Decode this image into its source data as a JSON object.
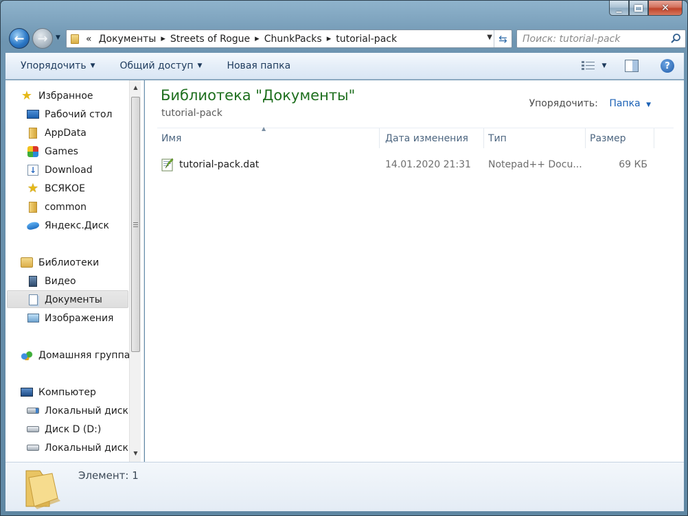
{
  "window": {
    "caption": {
      "minimize": "▁",
      "maximize": "□",
      "close": "✕"
    }
  },
  "nav": {
    "back_icon": "back-arrow-icon",
    "forward_icon": "forward-arrow-icon",
    "breadcrumb_prefix": "«",
    "breadcrumbs": [
      "Документы",
      "Streets of Rogue",
      "ChunkPacks",
      "tutorial-pack"
    ],
    "search_placeholder": "Поиск: tutorial-pack"
  },
  "toolbar": {
    "organize_label": "Упорядочить",
    "share_label": "Общий доступ",
    "new_folder_label": "Новая папка"
  },
  "sidebar": {
    "favorites": {
      "label": "Избранное",
      "items": [
        {
          "label": "Рабочий стол"
        },
        {
          "label": "AppData"
        },
        {
          "label": "Games"
        },
        {
          "label": "Download"
        },
        {
          "label": "ВСЯКОЕ"
        },
        {
          "label": "common"
        },
        {
          "label": "Яндекс.Диск"
        }
      ]
    },
    "libraries": {
      "label": "Библиотеки",
      "items": [
        {
          "label": "Видео"
        },
        {
          "label": "Документы"
        },
        {
          "label": "Изображения"
        }
      ]
    },
    "homegroup": {
      "label": "Домашняя группа"
    },
    "computer": {
      "label": "Компьютер",
      "items": [
        {
          "label": "Локальный диск ("
        },
        {
          "label": "Диск D (D:)"
        },
        {
          "label": "Локальный диск ("
        }
      ]
    }
  },
  "main": {
    "title": "Библиотека \"Документы\"",
    "subtitle": "tutorial-pack",
    "arrange_label": "Упорядочить:",
    "arrange_value": "Папка",
    "columns": {
      "name": "Имя",
      "date": "Дата изменения",
      "type": "Тип",
      "size": "Размер"
    },
    "files": [
      {
        "name": "tutorial-pack.dat",
        "date": "14.01.2020 21:31",
        "type": "Notepad++ Docu...",
        "size": "69 КБ"
      }
    ]
  },
  "details": {
    "text": "Элемент: 1"
  }
}
